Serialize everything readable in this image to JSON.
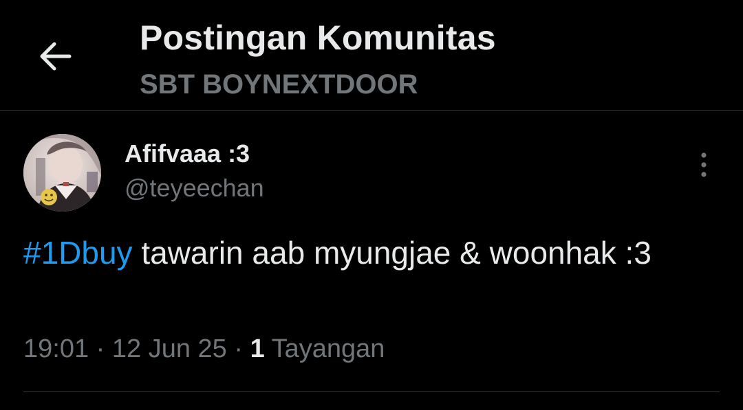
{
  "header": {
    "back_icon": "arrow-left-icon",
    "title": "Postingan Komunitas",
    "subtitle": "SBT BOYNEXTDOOR"
  },
  "post": {
    "author": {
      "display_name": "Afifvaaa :3",
      "handle": "@teyeechan",
      "avatar_icon": "profile-photo"
    },
    "more_icon": "more-vertical-icon",
    "hashtag": "#1Dbuy",
    "text": " tawarin aab myungjae & woonhak :3",
    "time": "19:01",
    "date": "12 Jun 25",
    "separator": " · ",
    "views_count": "1",
    "views_label": " Tayangan"
  },
  "colors": {
    "background": "#000000",
    "primary_text": "#e7e9ea",
    "secondary_text": "#71767b",
    "accent": "#1d9bf0",
    "divider": "#2f3336"
  }
}
